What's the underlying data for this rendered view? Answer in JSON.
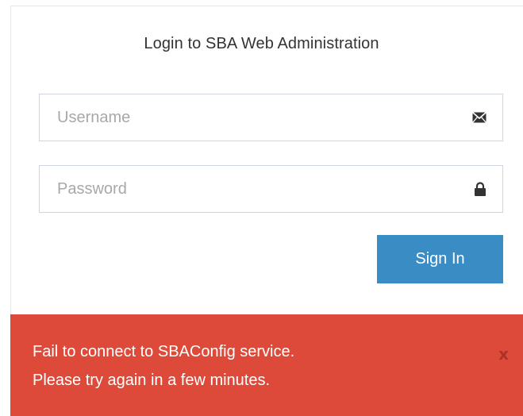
{
  "login": {
    "title": "Login to SBA Web Administration",
    "username": {
      "placeholder": "Username",
      "value": "",
      "icon": "envelope-icon"
    },
    "password": {
      "placeholder": "Password",
      "value": "",
      "icon": "lock-icon"
    },
    "sign_in_label": "Sign In"
  },
  "alert": {
    "line1": "Fail to connect to SBAConfig service.",
    "line2": "Please try again in a few minutes.",
    "close_label": "x"
  },
  "colors": {
    "button_bg": "#3a8cc4",
    "alert_bg": "#de4a39",
    "alert_close": "#a93326",
    "field_border": "#cfd6e0",
    "placeholder": "#a8a8a8"
  }
}
